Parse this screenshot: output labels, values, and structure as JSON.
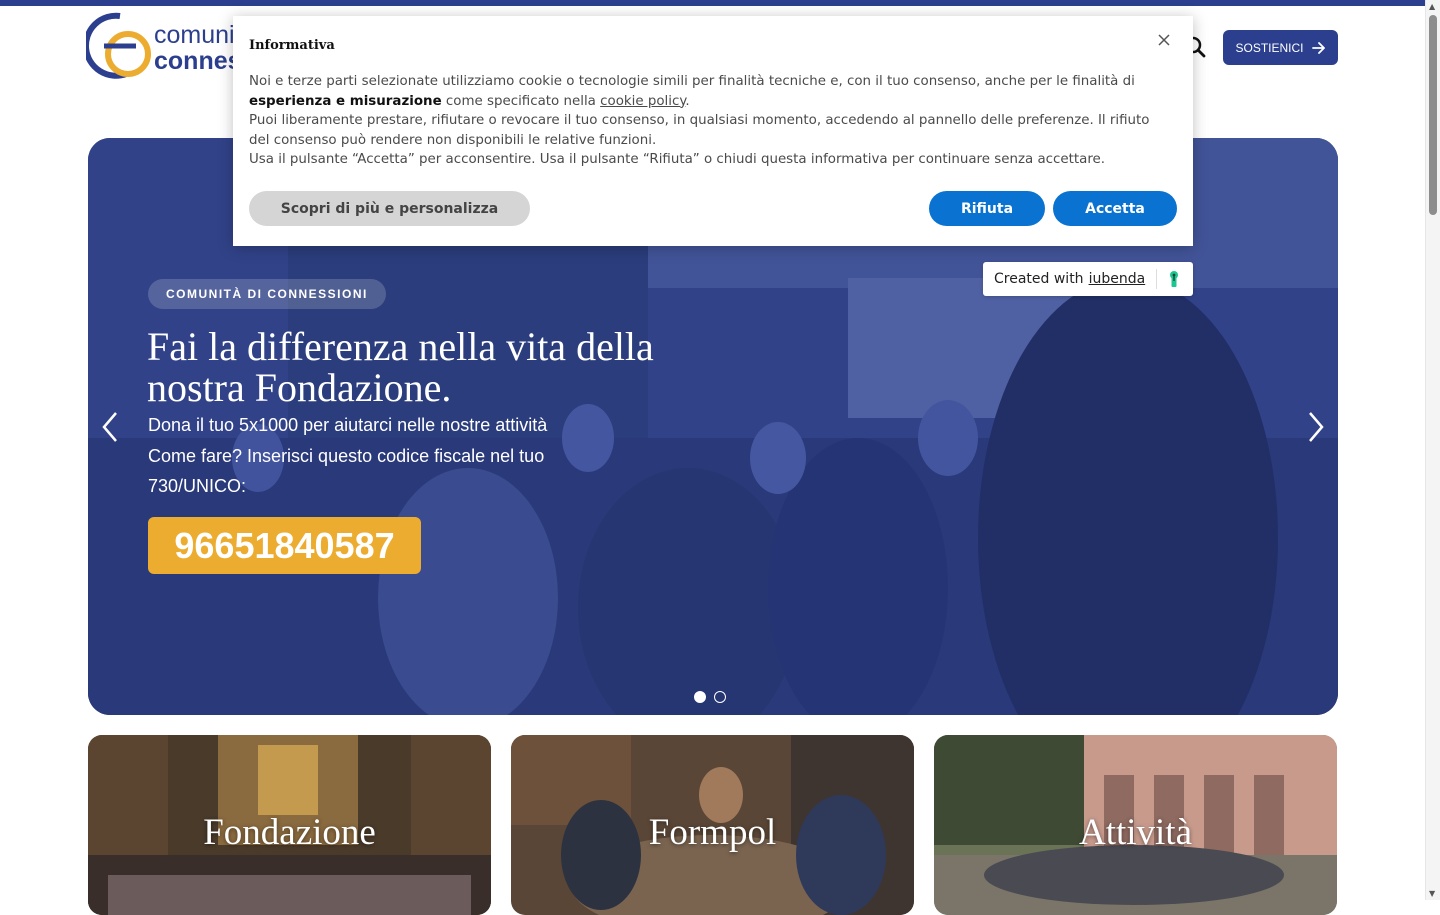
{
  "header": {
    "logo_line1": "comunità",
    "logo_line2": "connessioni",
    "support_label": "SOSTIENICI",
    "icons": [
      "search-icon",
      "arrow-right-icon"
    ]
  },
  "hero": {
    "badge": "COMUNITÀ DI CONNESSIONI",
    "title": "Fai la differenza nella vita della nostra Fondazione.",
    "text_line1": "Dona il tuo 5x1000 per aiutarci nelle nostre attività",
    "text_line2": "Come fare? Inserisci questo codice fiscale nel tuo 730/UNICO:",
    "code": "96651840587",
    "slides_total": 2,
    "slide_active": 1,
    "code_color": "#ecac2f"
  },
  "cards": [
    {
      "title": "Fondazione"
    },
    {
      "title": "Formpol"
    },
    {
      "title": "Attività"
    }
  ],
  "cookie": {
    "title": "Informativa",
    "p1_a": "Noi e terze parti selezionate utilizziamo cookie o tecnologie simili per finalità tecniche e, con il tuo consenso, anche per le finalità di ",
    "p1_bold": "esperienza e misurazione",
    "p1_b": " come specificato nella ",
    "p1_link": "cookie policy",
    "p1_end": ".",
    "p2": "Puoi liberamente prestare, rifiutare o revocare il tuo consenso, in qualsiasi momento, accedendo al pannello delle preferenze. Il rifiuto del consenso può rendere non disponibili le relative funzioni.",
    "p3": "Usa il pulsante “Accetta” per acconsentire. Usa il pulsante “Rifiuta” o chiudi questa informativa per continuare senza accettare.",
    "more_label": "Scopri di più e personalizza",
    "reject_label": "Rifiuta",
    "accept_label": "Accetta",
    "accent_color": "#0a73d1"
  },
  "iubenda": {
    "prefix": "Created with",
    "brand": "iubenda"
  },
  "colors": {
    "brand_blue": "#2b3f8e",
    "brand_yellow": "#ecac2f"
  }
}
